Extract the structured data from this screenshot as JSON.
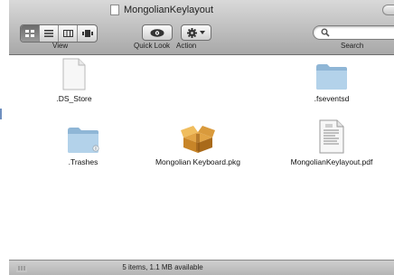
{
  "window": {
    "title": "MongolianKeylayout"
  },
  "toolbar": {
    "view_label": "View",
    "quicklook_label": "Quick Look",
    "action_label": "Action",
    "search_label": "Search",
    "view_modes": [
      {
        "name": "icon-view",
        "active": true
      },
      {
        "name": "list-view",
        "active": false
      },
      {
        "name": "column-view",
        "active": false
      },
      {
        "name": "coverflow-view",
        "active": false
      }
    ]
  },
  "files": [
    {
      "name": ".DS_Store",
      "icon": "document-icon"
    },
    {
      "name": ".fseventsd",
      "icon": "folder-icon"
    },
    {
      "name": ".Trashes",
      "icon": "folder-icon"
    },
    {
      "name": "Mongolian Keyboard.pkg",
      "icon": "package-icon"
    },
    {
      "name": "MongolianKeylayout.pdf",
      "icon": "pdf-icon"
    }
  ],
  "status": {
    "text": "5 items, 1.1 MB available"
  },
  "colors": {
    "folder": "#a9cbe6",
    "window_chrome": "#b8b8b8"
  }
}
